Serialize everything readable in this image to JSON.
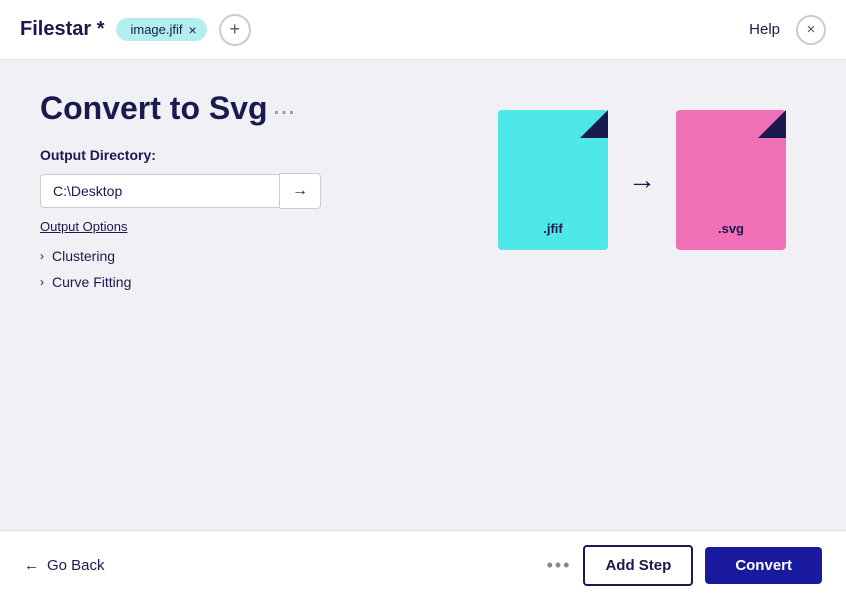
{
  "header": {
    "app_title": "Filestar *",
    "file_tag": "image.jfif",
    "help_label": "Help",
    "close_label": "×",
    "add_label": "+"
  },
  "main": {
    "page_title": "Convert to Svg",
    "title_dots": "...",
    "output_directory_label": "Output Directory:",
    "directory_value": "C:\\Desktop",
    "output_options_label": "Output Options",
    "options": [
      {
        "label": "Clustering"
      },
      {
        "label": "Curve Fitting"
      }
    ],
    "file_from_ext": ".jfif",
    "file_to_ext": ".svg"
  },
  "footer": {
    "go_back_label": "Go Back",
    "more_dots": "•••",
    "add_step_label": "Add Step",
    "convert_label": "Convert"
  }
}
